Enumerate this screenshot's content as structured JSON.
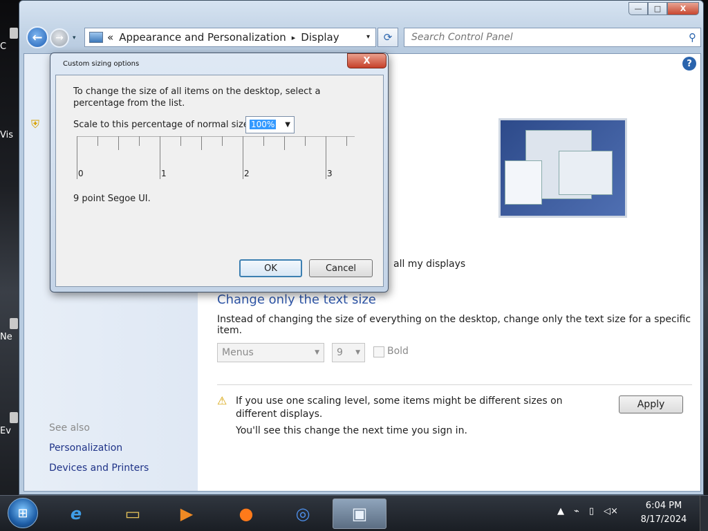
{
  "desktop": {
    "icons": [
      {
        "label": "C"
      },
      {
        "label": "Vis"
      },
      {
        "label": "Ne"
      },
      {
        "label": "Ev"
      }
    ]
  },
  "window": {
    "caption": {
      "minimize": "—",
      "maximize": "□",
      "close": "X"
    },
    "nav": {
      "back": "←",
      "forward": "→",
      "history_dropdown": "▾"
    },
    "address": {
      "overflow": "«",
      "crumbs": [
        "Appearance and Personalization",
        "Display"
      ],
      "separator": "▸",
      "dropdown": "▾"
    },
    "refresh": "⟳",
    "search": {
      "placeholder": "Search Control Panel",
      "icon": "magnifier-icon"
    },
    "help": "?",
    "left_pane": {
      "see_also": "See also",
      "links": [
        "Personalization",
        "Devices and Printers"
      ]
    },
    "main": {
      "apply_all_text": "all my displays",
      "section_title": "Change only the text size",
      "section_desc": "Instead of changing the size of everything on the desktop, change only the text size for a specific item.",
      "item_select": "Menus",
      "size_select": "9",
      "bold_label": "Bold",
      "warning": "If you use one scaling level, some items might be different sizes on different displays.",
      "signin_note": "You'll see this change the next time you sign in.",
      "apply_button": "Apply"
    }
  },
  "dialog": {
    "title": "Custom sizing options",
    "close": "X",
    "intro": "To change the size of all items on the desktop, select a percentage from the list.",
    "scale_label": "Scale to this percentage of normal size:",
    "scale_value": "100%",
    "ruler_labels": [
      "0",
      "1",
      "2",
      "3"
    ],
    "font_info": "9 point Segoe UI.",
    "ok": "OK",
    "cancel": "Cancel"
  },
  "taskbar": {
    "start": "⊞",
    "apps": [
      {
        "name": "internet-explorer",
        "glyph": "e"
      },
      {
        "name": "file-explorer",
        "glyph": "▭"
      },
      {
        "name": "media-player",
        "glyph": "▶"
      },
      {
        "name": "firefox",
        "glyph": "●"
      },
      {
        "name": "chrome",
        "glyph": "◎"
      },
      {
        "name": "control-panel",
        "glyph": "▣"
      }
    ],
    "tray": {
      "show_hidden": "▲",
      "network": "⌁",
      "power": "▯",
      "volume": "◁×"
    },
    "time": "6:04 PM",
    "date": "8/17/2024"
  },
  "colors": {
    "link": "#1e3287",
    "heading": "#2e56a8",
    "selection": "#3399ff",
    "close_red": "#c6402a"
  }
}
